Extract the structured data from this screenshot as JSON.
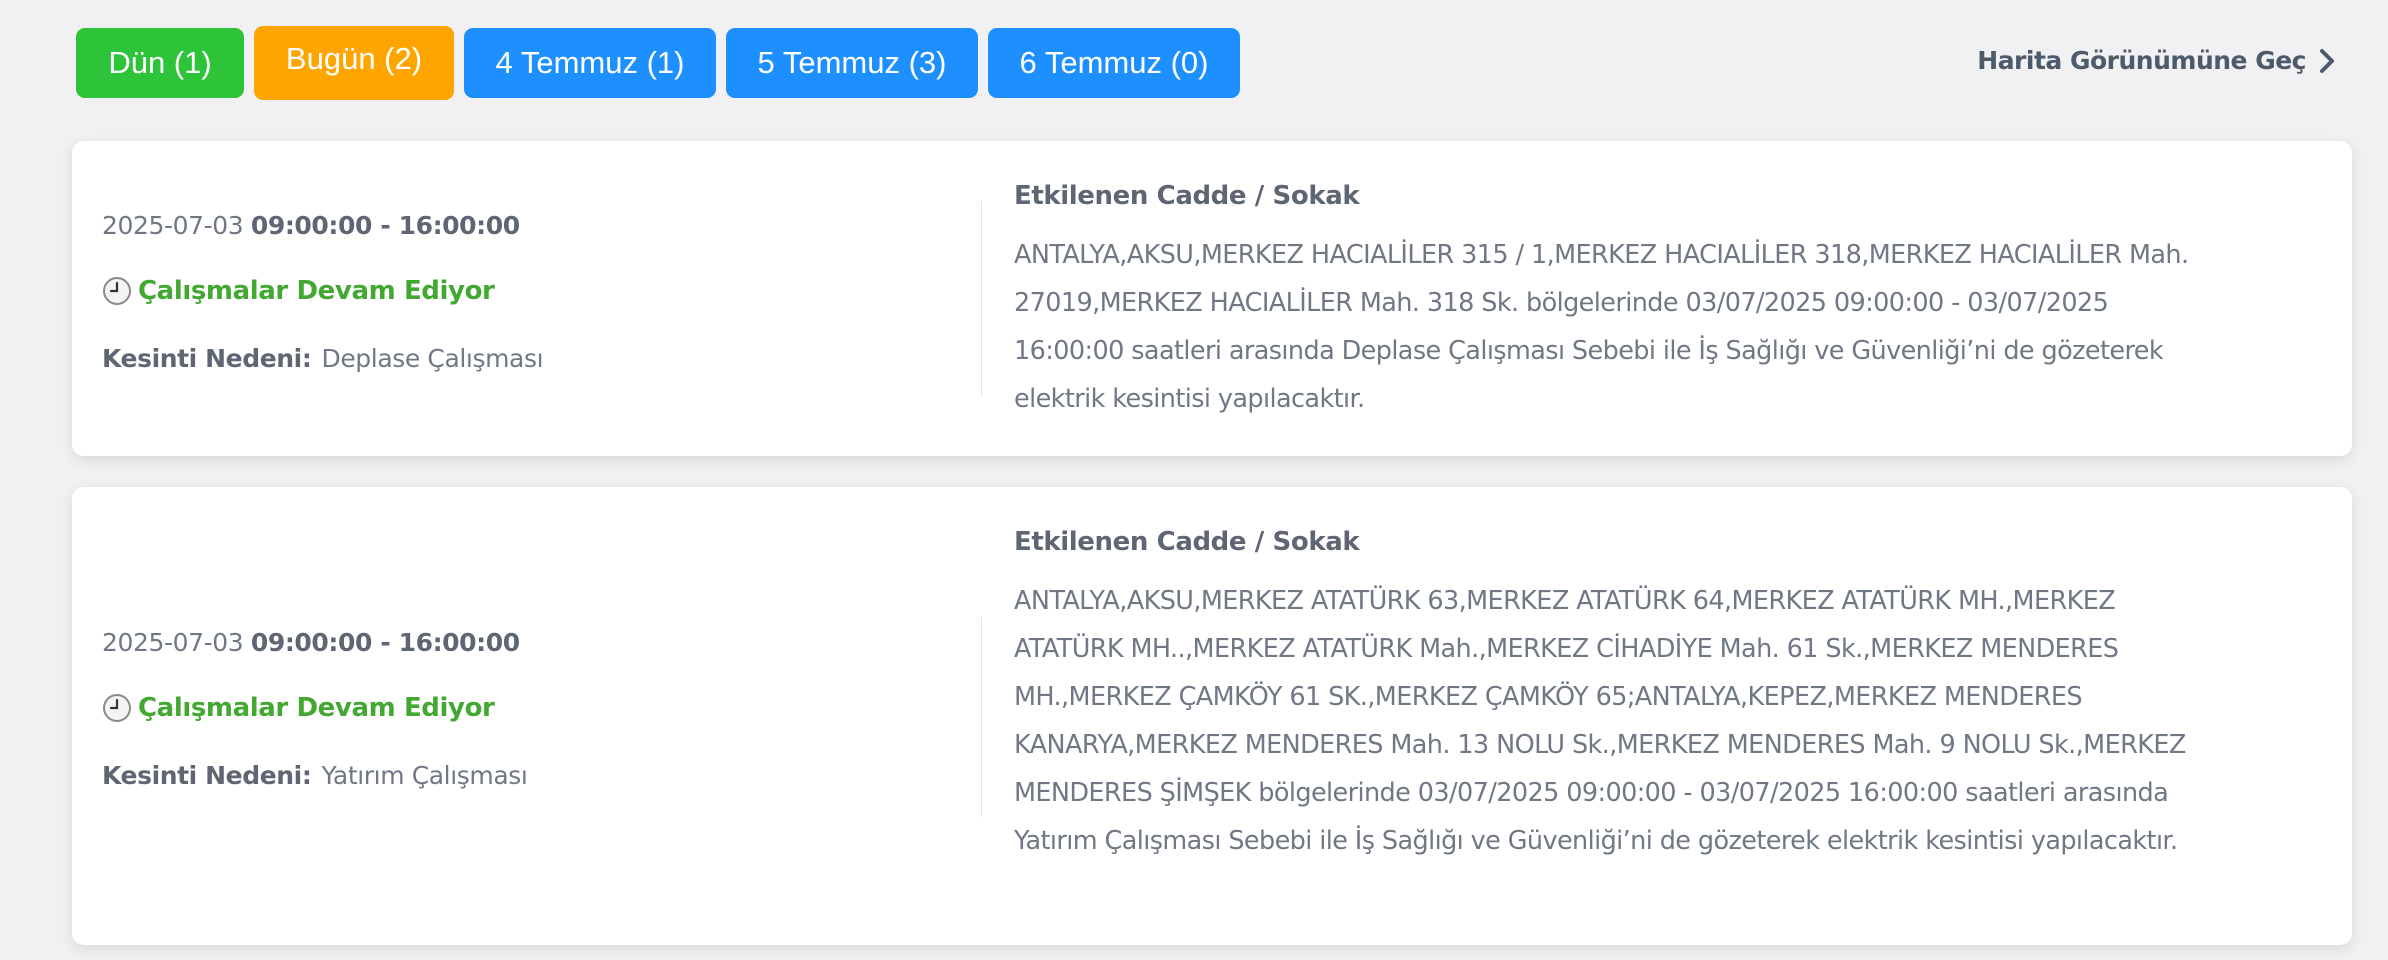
{
  "tabs": [
    {
      "label": "Dün (1)",
      "color": "#2ec43a"
    },
    {
      "label": "Bugün (2)",
      "color": "#ffa500"
    },
    {
      "label": "4 Temmuz (1)",
      "color": "#1e8fff"
    },
    {
      "label": "5 Temmuz (3)",
      "color": "#1e8fff"
    },
    {
      "label": "6 Temmuz (0)",
      "color": "#1e8fff"
    }
  ],
  "map_link": {
    "label": "Harita Görünümüne Geç",
    "icon": "chevron-right-icon"
  },
  "outages": [
    {
      "date": "2025-07-03",
      "time_range": "09:00:00 - 16:00:00",
      "status": "Çalışmalar Devam Ediyor",
      "status_icon": "clock-icon",
      "reason_label": "Kesinti Nedeni:",
      "reason": "Deplase Çalışması",
      "streets_title": "Etkilenen Cadde / Sokak",
      "description": "ANTALYA,AKSU,MERKEZ HACIALİLER 315 / 1,MERKEZ HACIALİLER 318,MERKEZ HACIALİLER Mah. 27019,MERKEZ HACIALİLER Mah. 318 Sk. bölgelerinde 03/07/2025 09:00:00 - 03/07/2025 16:00:00 saatleri arasında Deplase Çalışması Sebebi ile İş Sağlığı ve Güvenliği’ni de gözeterek elektrik kesintisi yapılacaktır."
    },
    {
      "date": "2025-07-03",
      "time_range": "09:00:00 - 16:00:00",
      "status": "Çalışmalar Devam Ediyor",
      "status_icon": "clock-icon",
      "reason_label": "Kesinti Nedeni:",
      "reason": "Yatırım Çalışması",
      "streets_title": "Etkilenen Cadde / Sokak",
      "description": "ANTALYA,AKSU,MERKEZ ATATÜRK 63,MERKEZ ATATÜRK 64,MERKEZ ATATÜRK MH.,MERKEZ ATATÜRK MH..,MERKEZ ATATÜRK Mah.,MERKEZ CİHADİYE Mah. 61 Sk.,MERKEZ MENDERES MH.,MERKEZ ÇAMKÖY 61 SK.,MERKEZ ÇAMKÖY 65;ANTALYA,KEPEZ,MERKEZ MENDERES KANARYA,MERKEZ MENDERES Mah. 13 NOLU Sk.,MERKEZ MENDERES Mah. 9 NOLU Sk.,MERKEZ MENDERES ŞİMŞEK bölgelerinde 03/07/2025 09:00:00 - 03/07/2025 16:00:00 saatleri arasında Yatırım Çalışması Sebebi ile İş Sağlığı ve Güvenliği’ni de gözeterek elektrik kesintisi yapılacaktır."
    }
  ],
  "colors": {
    "status_green": "#43a832",
    "text_gray": "#6f7884"
  }
}
